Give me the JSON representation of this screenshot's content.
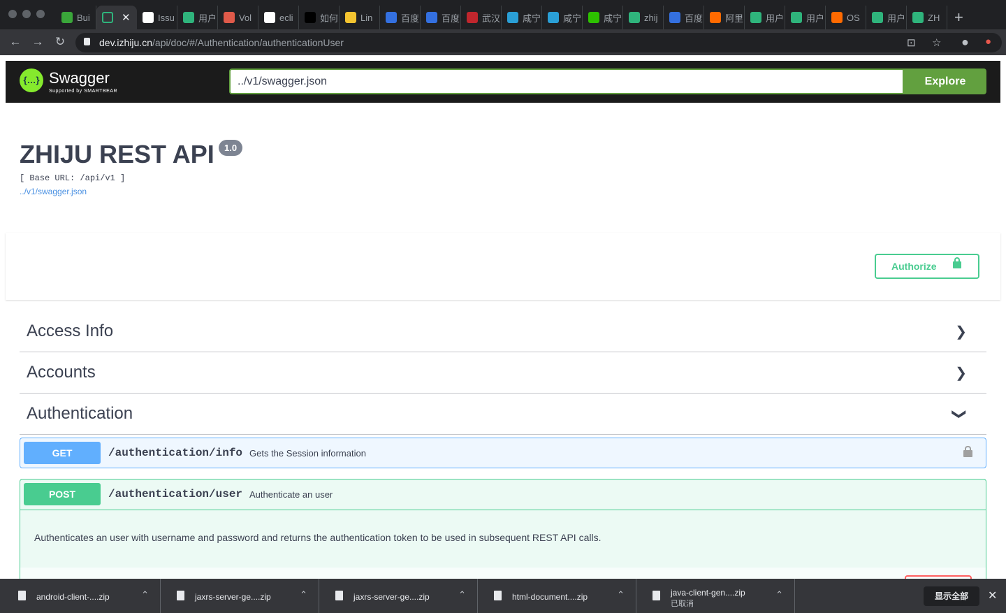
{
  "browser": {
    "tabs": [
      {
        "label": "Bui",
        "icon": "build-icon",
        "color": "#3aa63a"
      },
      {
        "label": "",
        "icon": "zhiju-icon",
        "color": "#35363a",
        "active": true
      },
      {
        "label": "Issu",
        "icon": "github-icon",
        "color": "#ffffff"
      },
      {
        "label": "用户",
        "icon": "zhiju-icon",
        "color": "#2fb47c"
      },
      {
        "label": "Vol",
        "icon": "jianshu-icon",
        "color": "#e05a4a"
      },
      {
        "label": "ecli",
        "icon": "github-icon",
        "color": "#ffffff"
      },
      {
        "label": "如何",
        "icon": "symfony-icon",
        "color": "#000000"
      },
      {
        "label": "Lin",
        "icon": "linux-icon",
        "color": "#f4c430"
      },
      {
        "label": "百度",
        "icon": "baidu-icon",
        "color": "#3470e0"
      },
      {
        "label": "百度",
        "icon": "baidu-icon",
        "color": "#3470e0"
      },
      {
        "label": "武汉",
        "icon": "site-icon",
        "color": "#c0262d"
      },
      {
        "label": "咸宁",
        "icon": "bird-icon",
        "color": "#2a9fd6"
      },
      {
        "label": "咸宁",
        "icon": "bird-icon",
        "color": "#2a9fd6"
      },
      {
        "label": "咸宁",
        "icon": "wechat-icon",
        "color": "#2dc100"
      },
      {
        "label": "zhij",
        "icon": "zhiju-icon",
        "color": "#2fb47c"
      },
      {
        "label": "百度",
        "icon": "cloud-icon",
        "color": "#3470e0"
      },
      {
        "label": "阿里",
        "icon": "aliyun-icon",
        "color": "#ff6a00"
      },
      {
        "label": "用户",
        "icon": "zhiju-icon",
        "color": "#2fb47c"
      },
      {
        "label": "用户",
        "icon": "zhiju-icon",
        "color": "#2fb47c"
      },
      {
        "label": "OS",
        "icon": "aliyun-icon",
        "color": "#ff6a00"
      },
      {
        "label": "用户",
        "icon": "zhiju-icon",
        "color": "#2fb47c"
      },
      {
        "label": "ZH",
        "icon": "zhiju-icon",
        "color": "#2fb47c"
      }
    ],
    "url_host": "dev.izhiju.cn",
    "url_path": "/api/doc/#/Authentication/authenticationUser"
  },
  "topbar": {
    "logo_name": "Swagger",
    "logo_sub": "Supported by SMARTBEAR",
    "spec_url": "../v1/swagger.json",
    "explore_label": "Explore"
  },
  "info": {
    "title": "ZHIJU REST API",
    "version": "1.0",
    "base_url": "[ Base URL: /api/v1 ]",
    "spec_link": "../v1/swagger.json"
  },
  "authorize_label": "Authorize",
  "tags": [
    {
      "name": "Access Info",
      "expanded": false
    },
    {
      "name": "Accounts",
      "expanded": false
    },
    {
      "name": "Authentication",
      "expanded": true
    }
  ],
  "operations": {
    "get": {
      "method": "GET",
      "path": "/authentication/info",
      "summary": "Gets the Session information"
    },
    "post": {
      "method": "POST",
      "path": "/authentication/user",
      "summary": "Authenticate an user",
      "description": "Authenticates an user with username and password and returns the authentication token to be used in subsequent REST API calls."
    }
  },
  "downloads": [
    {
      "name": "android-client-....zip",
      "status": ""
    },
    {
      "name": "jaxrs-server-ge....zip",
      "status": ""
    },
    {
      "name": "jaxrs-server-ge....zip",
      "status": ""
    },
    {
      "name": "html-document....zip",
      "status": ""
    },
    {
      "name": "java-client-gen....zip",
      "status": "已取消"
    }
  ],
  "show_all_label": "显示全部",
  "colors": {
    "get": "#61affe",
    "post": "#49cc90",
    "explore": "#62a03f"
  }
}
